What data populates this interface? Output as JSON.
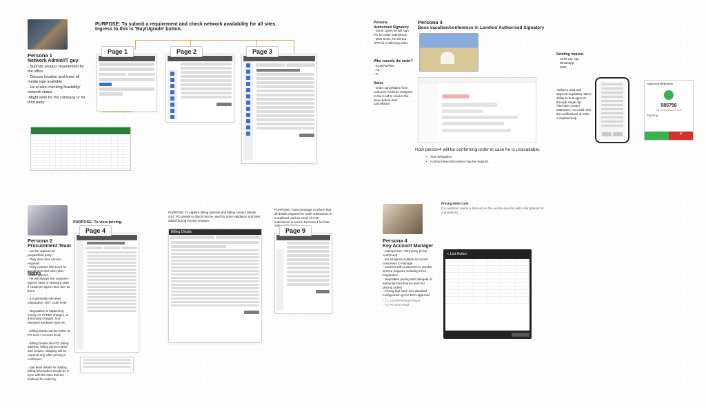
{
  "section1": {
    "persona1": {
      "title": "Persona 1",
      "role": "Network Admin/IT guy",
      "body": "- Submits product requirement for the office.\n- Discuss location and know all media type available\n- He is also checking feasibility/ network status\n-Might work for the company or for third party"
    },
    "purpose": "PURPOSE:  To submit a requirement and check network availability for all sites.\nIngress  to this is 'Buy/Ugrade' button.",
    "pages": {
      "p1": "Page 1",
      "p2": "Page 2",
      "p3": "Page 3"
    }
  },
  "section_p3": {
    "left": {
      "h": "Persona\nAuthorised Signatory",
      "b": "- Some cases he will sign PO for order submission\n- Most times, he will put OTP for confirming order"
    },
    "title": "Persona 3",
    "sub": "Boss vacation/conference in London/ Authorised Signatory",
    "cancel_h": "Who cancels the order?",
    "cancel_b": "- KAM/AM/RM..\n- AS\n- TI",
    "notes_h": "Notes",
    "notes_b": "- Order cancellation from customer could be assigned to the KAM to resolve the issue before final cancellation.",
    "confirm": "How person4 will be confirming order in case he is unavailable.",
    "confirm_b1": "Auto delegation",
    "confirm_b2": "Contract-level discussion may be required.",
    "send_h": "Sending request",
    "send_b": "Airtel Lite App\nWhatsapp\nSMS",
    "ability": "Ability to read and approve regulatory T&Cs; ability to bulk approve through single otp. Alternate contact statement: AS could miss the notifications of order completion/otp.",
    "app_label": "Approval Requests",
    "app_amount": "585756",
    "app_sub": "via consolidated view",
    "app_status": "Expiring"
  },
  "section2": {
    "persona2": {
      "title": "Persona 2",
      "role": "Procurement Team",
      "body": "- can be outsourced people/third party\n- They also raise service requests\n- They connect with KAM for negotiation and other plan-related queries",
      "notes_h": "Notes",
      "notes": "- He will always see customer-agreed rates or standard rates if customer-agree rates are not there.\n\n- It is generally site level negotiation, NOT order level.\n\n- Negotiation is happening mostly on CAPEX charges, or third party charges, non-standard hardware type etc.\n\n- Billing details can be either at PO level / Account level/\n\n- Billing Details like PO, billing address, billing person name and contact, shipping will be required only after pricing is confirmed.\n\n- Site level details for adding billing information should be in sync with the sites that are finalised for ordering."
    },
    "purpose4": "PURPOSE: To view pricing.",
    "purpose_billing": "PURPOSE: To capture billing address and billing contact details, GST, PO details so that it can be used for order validation and later added during invoice creation.",
    "purpose9": "PURPOSE: Toast message to inform that all details required for order submission is completed, and an email of OTP submission is sent to Persona 4 for final order submission.",
    "billing_hdr": "Billing Details",
    "pages": {
      "p4": "Page 4",
      "p9": "Page 9"
    }
  },
  "section_p4": {
    "title": "Persona 4",
    "role": "Key Account Manager",
    "body": "- Airtel person / third party (to be confirmed)\n- are assigned multiple accounts/ customers to manage\n- Connect with customers to resolve service requests including Price negotiation.\n- Negotiates pricing with delegate of authority/Artel finance team for placing orders\n- Pricing that have non-standard configuration go for DOA approval",
    "pricing_h": "Pricing NON-Code",
    "pricing_b": "If a customer wants a discount on the vendor-specific units only (placed for a quotation), ...",
    "list_title": "< List  Action"
  }
}
